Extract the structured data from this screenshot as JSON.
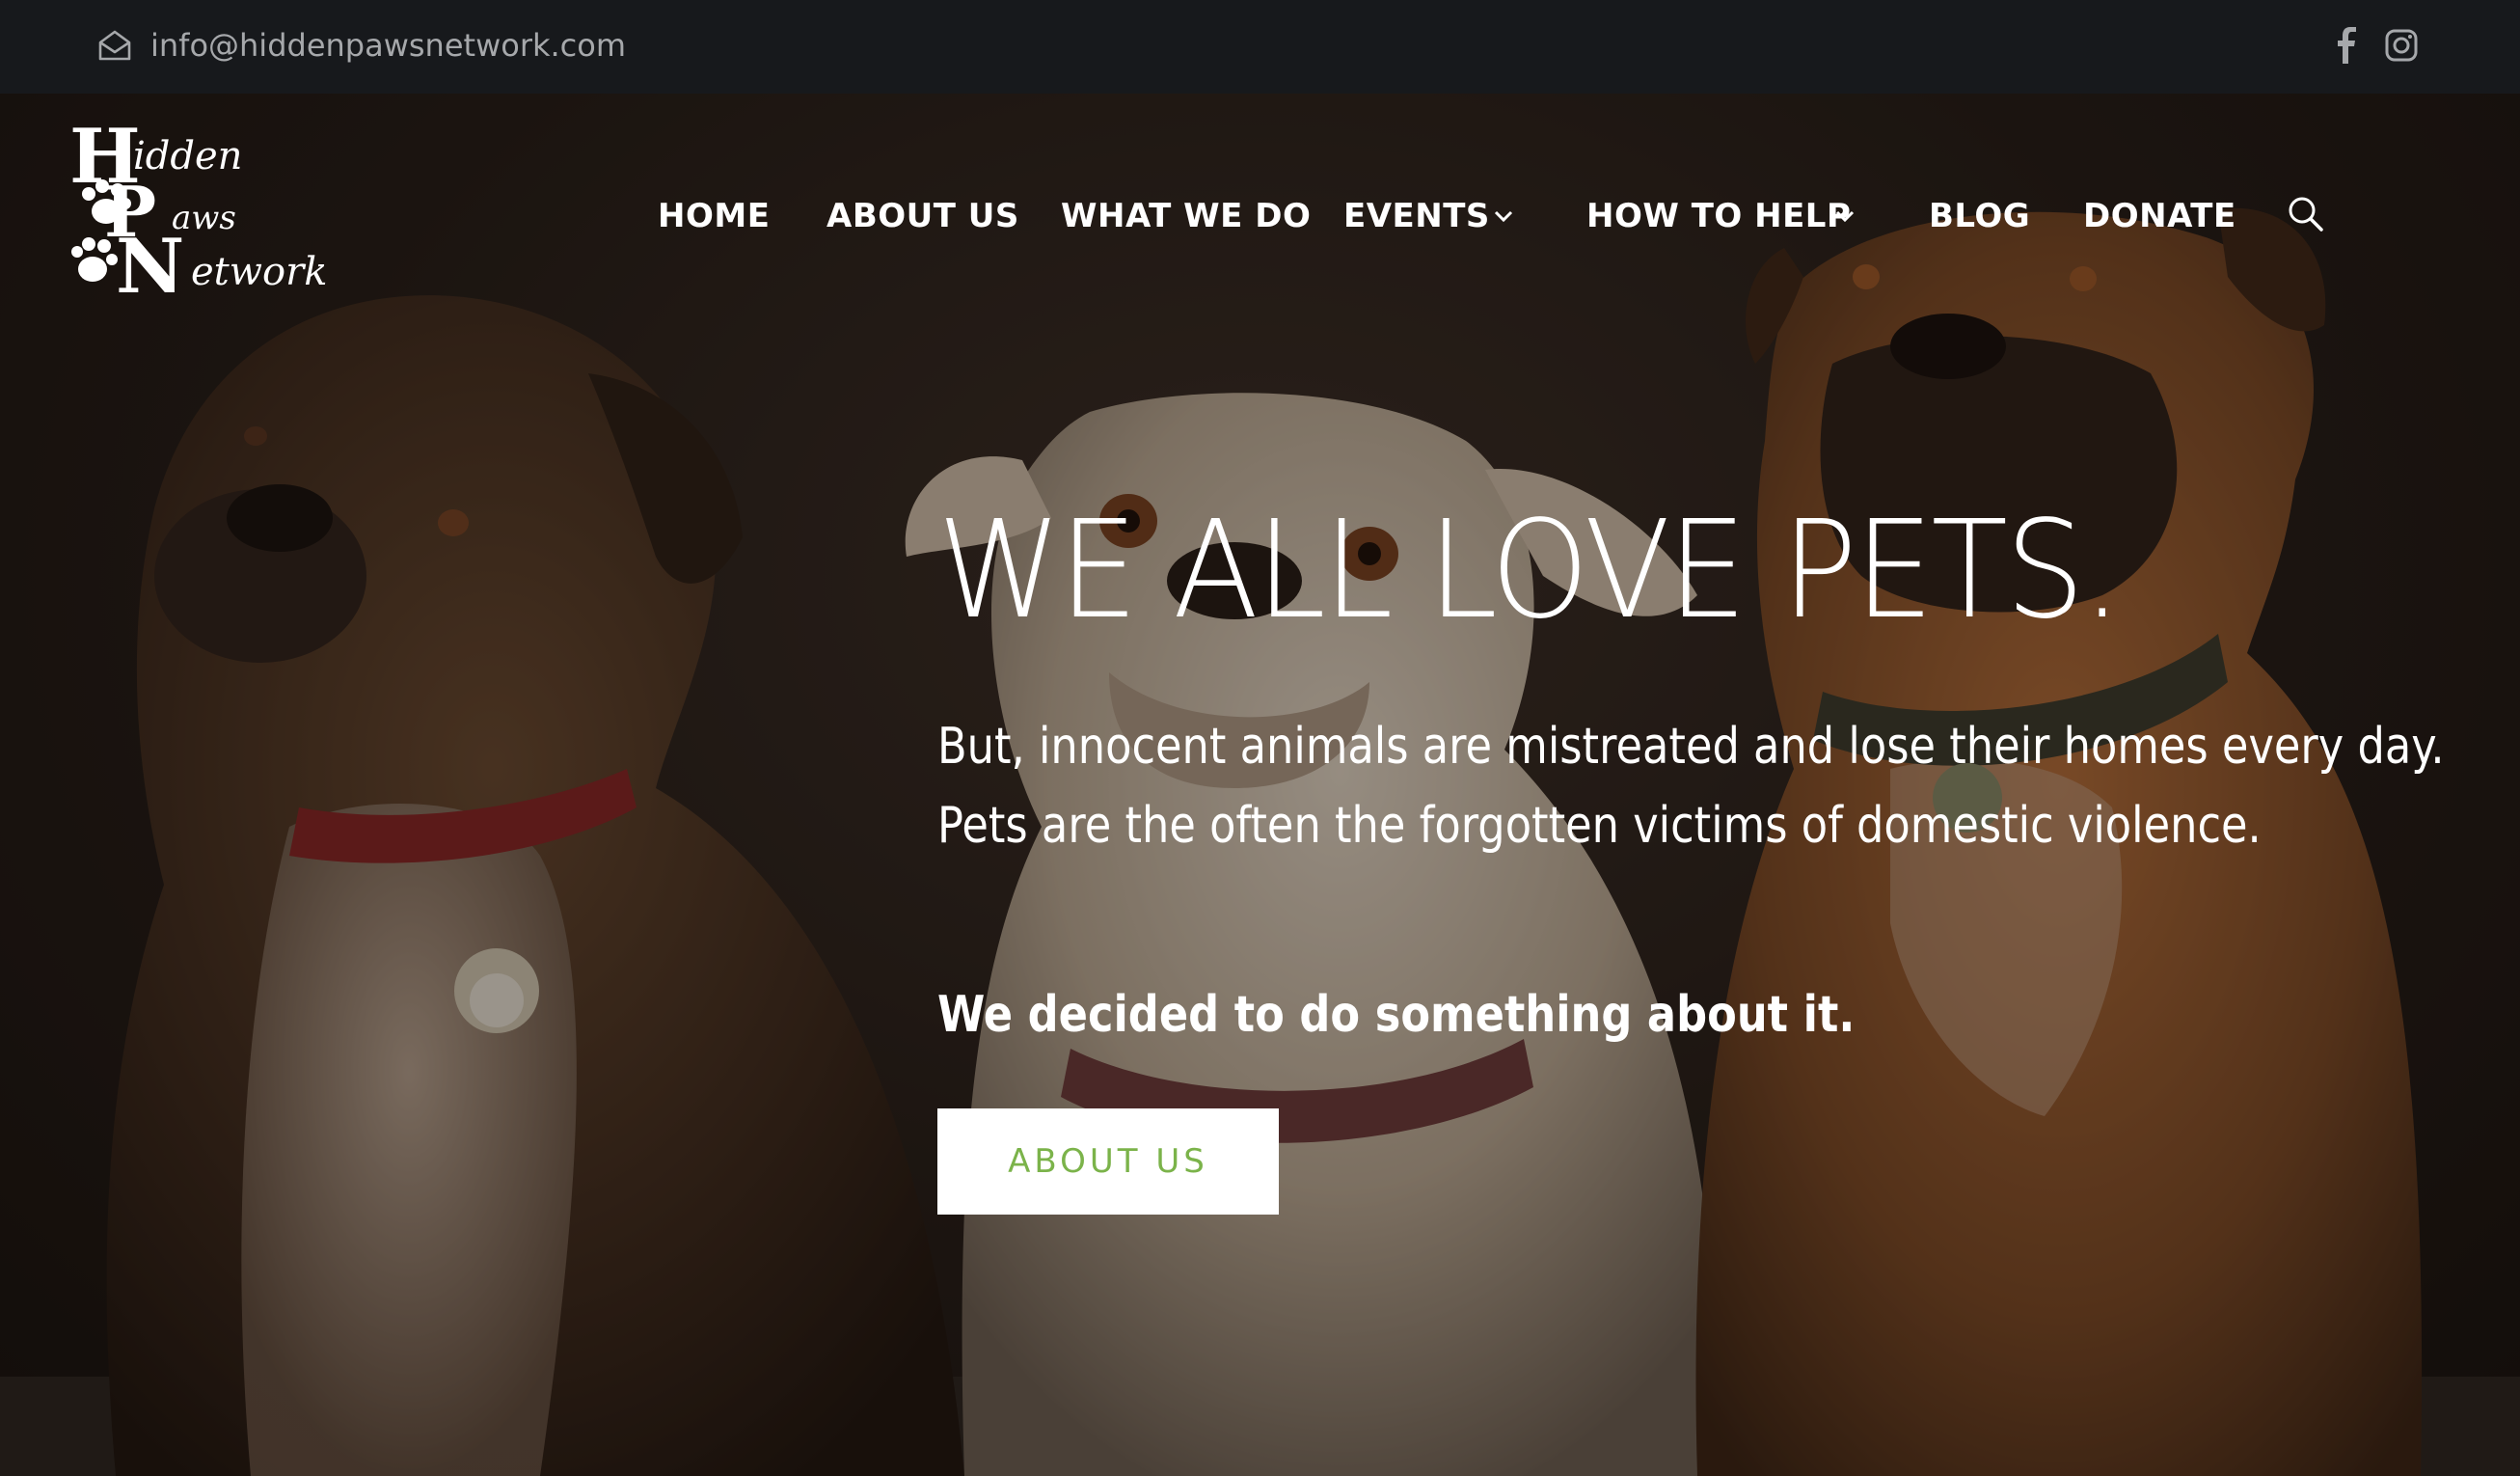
{
  "topbar": {
    "email": "info@hiddenpawsnetwork.com",
    "icons": [
      "mail-icon",
      "facebook-icon",
      "instagram-icon"
    ]
  },
  "logo": {
    "letters": [
      "H",
      "P",
      "N"
    ],
    "words": [
      "idden",
      "aws",
      "etwork"
    ]
  },
  "nav": {
    "items": [
      {
        "label": "HOME",
        "has_dropdown": false
      },
      {
        "label": "ABOUT US",
        "has_dropdown": false
      },
      {
        "label": "WHAT WE DO",
        "has_dropdown": false
      },
      {
        "label": "EVENTS",
        "has_dropdown": true
      },
      {
        "label": "HOW TO HELP",
        "has_dropdown": true
      },
      {
        "label": "BLOG",
        "has_dropdown": false
      },
      {
        "label": "DONATE",
        "has_dropdown": false
      }
    ],
    "search_icon": "search-icon"
  },
  "hero": {
    "headline": "WE ALL LOVE PETS.",
    "paragraph_lines": [
      "But, innocent animals are mistreated and lose their homes every day.",
      "Pets are the often the forgotten victims of domestic violence."
    ],
    "emphasis": "We decided to do something about it.",
    "cta_label": "ABOUT US"
  },
  "colors": {
    "topbar_bg": "#17191c",
    "cta_text": "#7bb34a",
    "cta_bg": "#ffffff",
    "nav_text": "#ffffff"
  }
}
